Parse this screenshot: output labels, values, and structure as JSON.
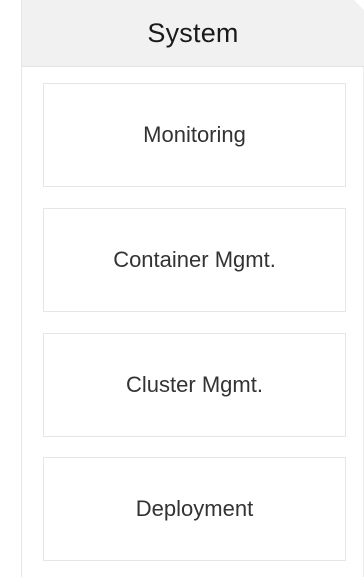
{
  "panel": {
    "title": "System",
    "items": [
      {
        "label": "Monitoring"
      },
      {
        "label": "Container Mgmt."
      },
      {
        "label": "Cluster Mgmt."
      },
      {
        "label": "Deployment"
      }
    ]
  },
  "colors": {
    "header_background": "#f1f1f1",
    "border": "#e6e6e6",
    "text": "#333333"
  }
}
